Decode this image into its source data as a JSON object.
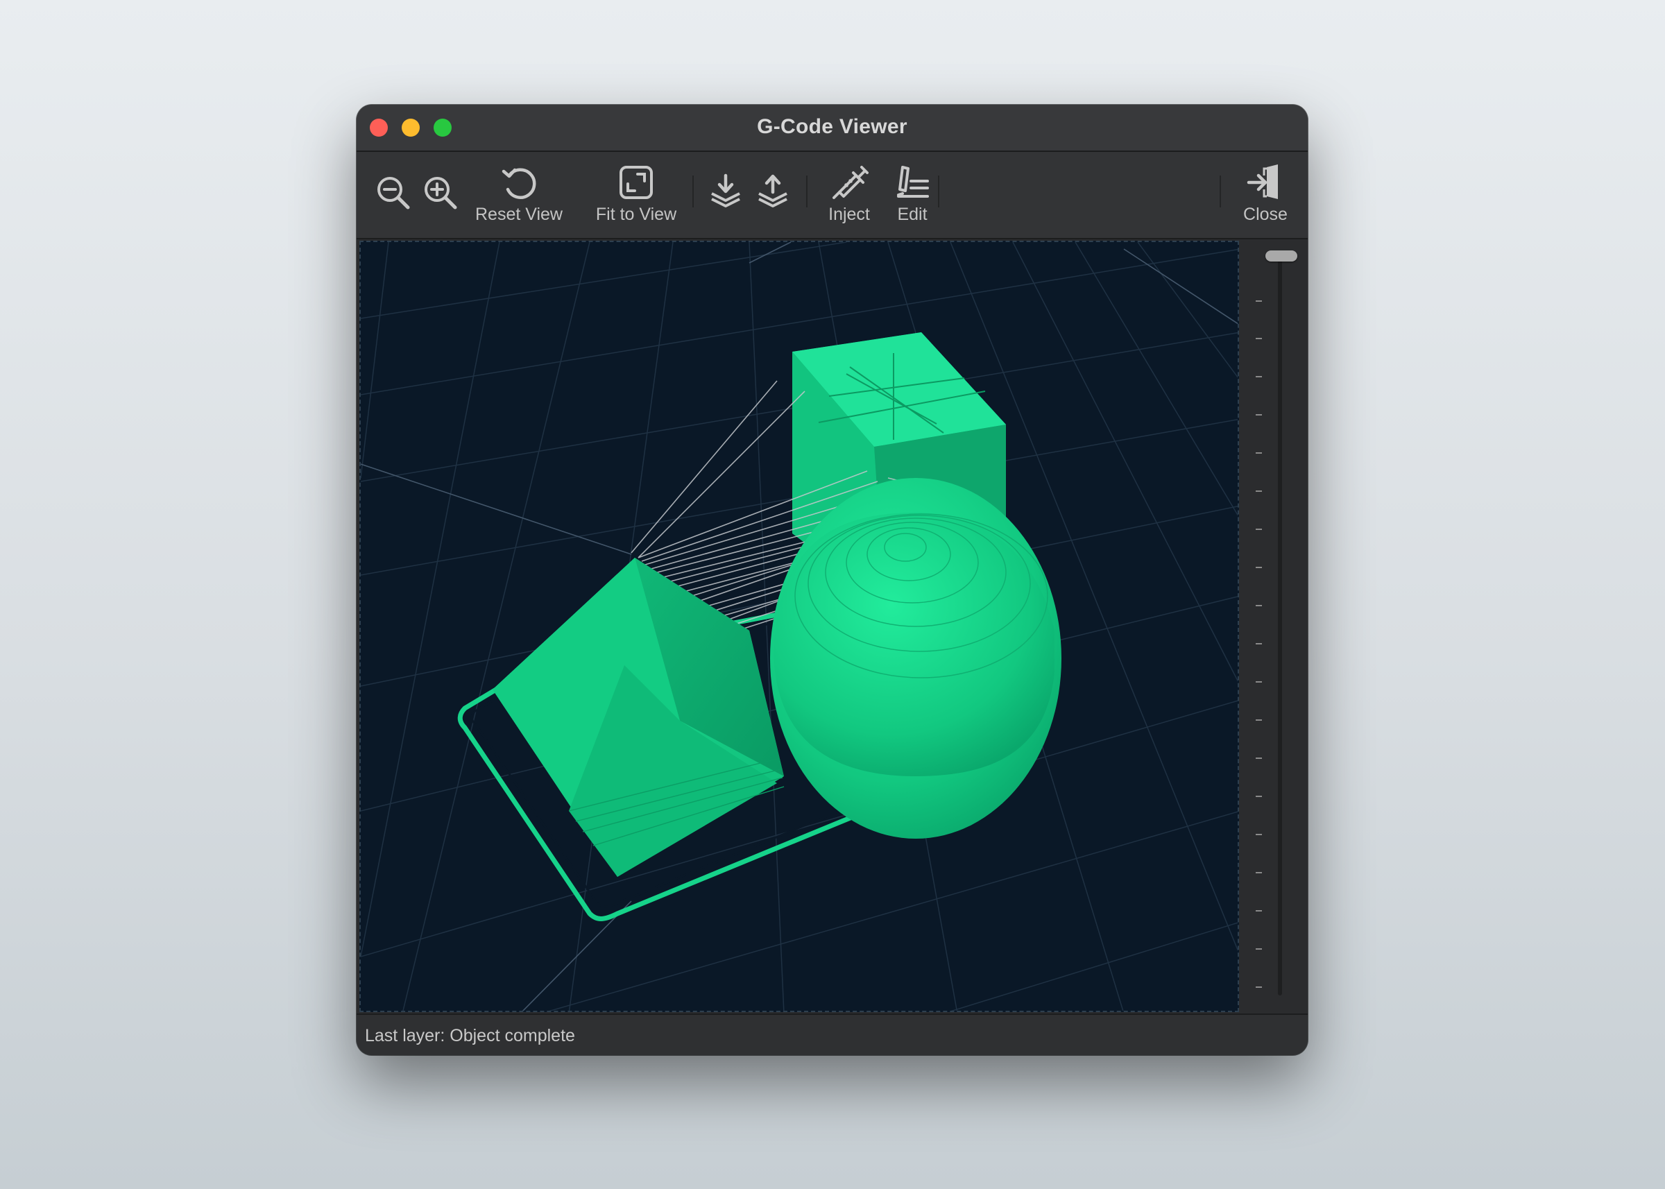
{
  "window": {
    "title": "G-Code Viewer"
  },
  "toolbar": {
    "zoom_out": {
      "icon": "zoom-out-icon"
    },
    "zoom_in": {
      "icon": "zoom-in-icon"
    },
    "reset_view": {
      "label": "Reset View",
      "icon": "rotate-ccw-icon"
    },
    "fit_to_view": {
      "label": "Fit to View",
      "icon": "fit-frame-icon"
    },
    "layer_down": {
      "icon": "layer-download-icon"
    },
    "layer_up": {
      "icon": "layer-upload-icon"
    },
    "inject": {
      "label": "Inject",
      "icon": "syringe-icon"
    },
    "edit": {
      "label": "Edit",
      "icon": "pen-lines-icon"
    },
    "close": {
      "label": "Close",
      "icon": "exit-door-icon"
    }
  },
  "viewport": {
    "model_color": "#15d68b",
    "travel_color": "#c0c4c8",
    "background": "#0a1827"
  },
  "layer_slider": {
    "position": "top",
    "value_fraction": 1.0
  },
  "status": {
    "text": "Last layer: Object complete"
  }
}
